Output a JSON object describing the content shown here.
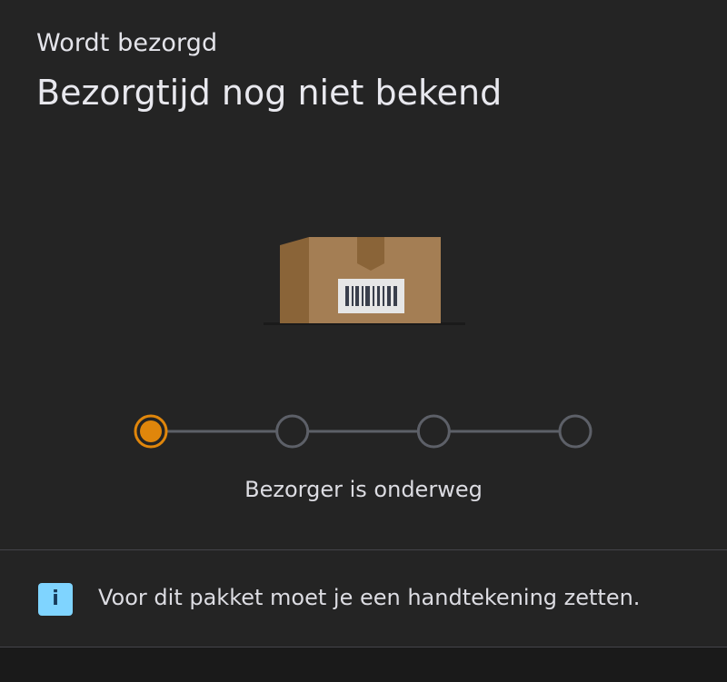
{
  "status": {
    "label": "Wordt bezorgd",
    "eta": "Bezorgtijd nog niet bekend"
  },
  "progress": {
    "steps_total": 4,
    "active_step": 1,
    "current_label": "Bezorger is onderweg",
    "active_color": "#e0860b",
    "inactive_color": "#5d6068"
  },
  "notice": {
    "icon": "info-icon",
    "icon_glyph": "i",
    "text": "Voor dit pakket moet je een handtekening zetten."
  },
  "colors": {
    "background": "#242424",
    "info_accent": "#7fd4ff"
  }
}
